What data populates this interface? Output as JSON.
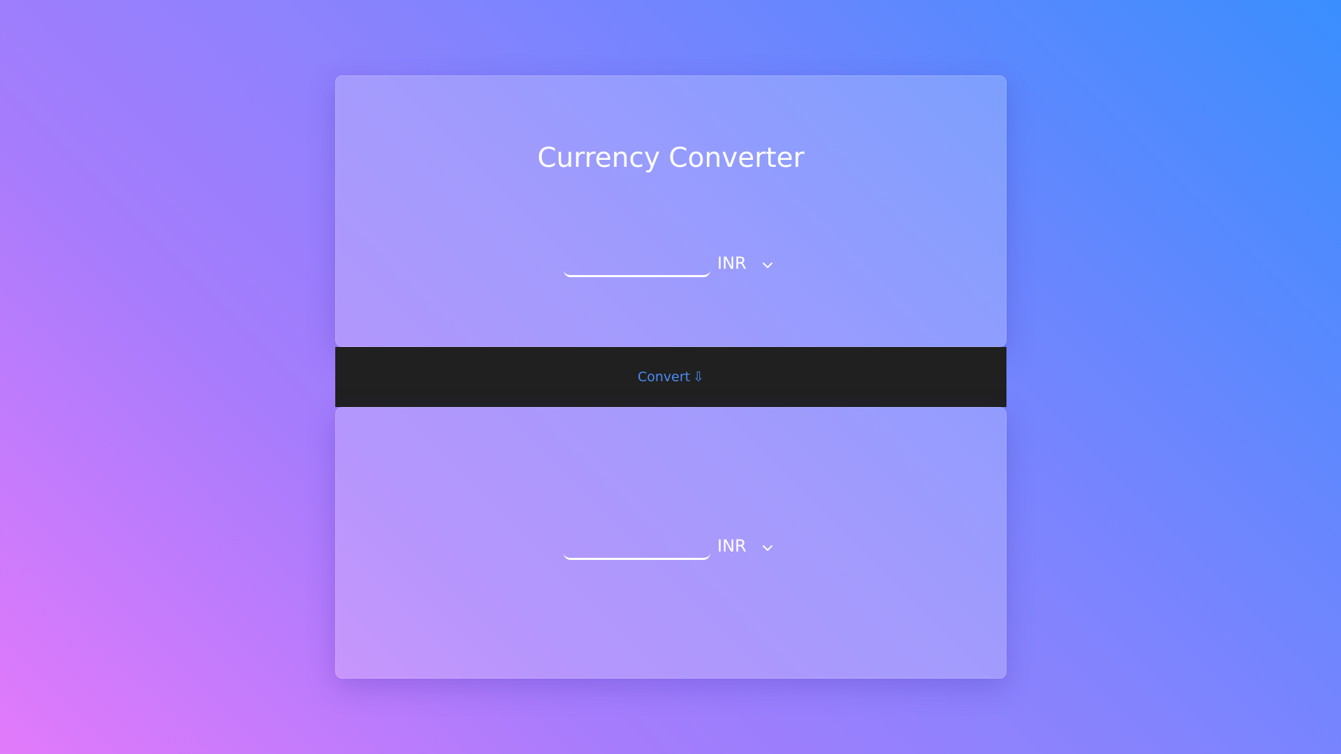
{
  "app": {
    "title": "Currency Converter"
  },
  "from": {
    "amount_value": "",
    "currency": "INR"
  },
  "action": {
    "convert_label": "Convert",
    "convert_icon": "⇩"
  },
  "to": {
    "amount_value": "",
    "currency": "INR"
  },
  "colors": {
    "gradient_start": "#e27afb",
    "gradient_end": "#3a8efe",
    "bar_background": "#202020",
    "button_text": "#4a8cf7",
    "text": "#ffffff"
  },
  "icons": {
    "dropdown": "chevron-down-icon",
    "convert": "down-arrow-icon"
  }
}
